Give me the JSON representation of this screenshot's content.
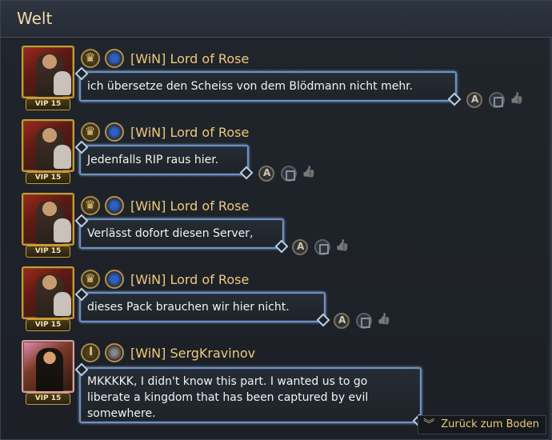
{
  "header": {
    "title": "Welt"
  },
  "messages": [
    {
      "vip": "VIP 15",
      "name": "[WiN] Lord of Rose",
      "text": "ich übersetze den Scheiss von dem Blödmann nicht mehr."
    },
    {
      "vip": "VIP 15",
      "name": "[WiN] Lord of Rose",
      "text": "Jedenfalls RIP raus hier."
    },
    {
      "vip": "VIP 15",
      "name": "[WiN] Lord of Rose",
      "text": "Verlässt dofort diesen Server,"
    },
    {
      "vip": "VIP 15",
      "name": "[WiN] Lord of Rose",
      "text": "dieses Pack brauchen wir hier nicht."
    },
    {
      "vip": "VIP 15",
      "name": "[WiN] SergKravinov",
      "text": "MKKKKK, I didn't know this part.  I wanted us to go liberate a kingdom that has been captured by evil somewhere."
    }
  ],
  "jump_button": {
    "label": "Zurück zum Boden"
  },
  "icons": {
    "title_badge": "crown-icon",
    "alliance_badge": "orb-icon",
    "translate": "translate-icon",
    "copy": "copy-icon",
    "like": "thumbs-up-icon",
    "jump": "double-chevron-down-icon"
  },
  "colors": {
    "name": "#f0c97a",
    "title": "#f2d9a8",
    "bubble_border": "#6f8fb8",
    "background": "#1f2329"
  }
}
